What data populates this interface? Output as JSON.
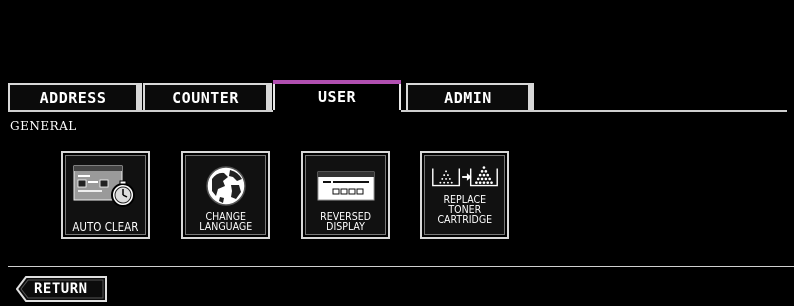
{
  "tabs": [
    {
      "label": "ADDRESS",
      "active": false
    },
    {
      "label": "COUNTER",
      "active": false
    },
    {
      "label": "USER",
      "active": true
    },
    {
      "label": "ADMIN",
      "active": false
    }
  ],
  "section": {
    "title": "GENERAL"
  },
  "tiles": [
    {
      "label": "AUTO CLEAR",
      "icon": "auto-clear-icon"
    },
    {
      "label": "CHANGE\nLANGUAGE",
      "icon": "globe-icon"
    },
    {
      "label": "REVERSED\nDISPLAY",
      "icon": "reversed-display-icon"
    },
    {
      "label": "REPLACE\nTONER\nCARTRIDGE",
      "icon": "toner-cartridge-icon"
    }
  ],
  "footer": {
    "return_label": "RETURN"
  },
  "colors": {
    "active_tab_accent": "#b04fb0",
    "background": "#000000",
    "frame": "#d9d9d9"
  }
}
